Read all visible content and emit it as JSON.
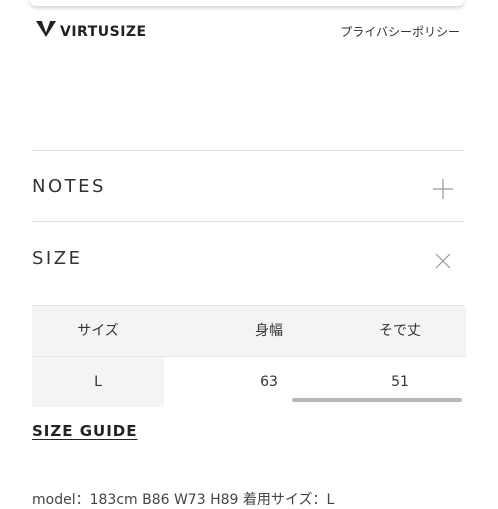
{
  "header": {
    "brand_label": "VIRTUSIZE",
    "privacy_link": "プライバシーポリシー"
  },
  "sections": {
    "notes_title": "NOTES",
    "size_title": "SIZE"
  },
  "size_table": {
    "columns": [
      "サイズ",
      "身幅",
      "そで丈"
    ],
    "rows": [
      [
        "L",
        "63",
        "51"
      ]
    ]
  },
  "size_guide_label": "SIZE GUIDE",
  "model_text": "model：183cm B86 W73 H89 着用サイズ：L"
}
